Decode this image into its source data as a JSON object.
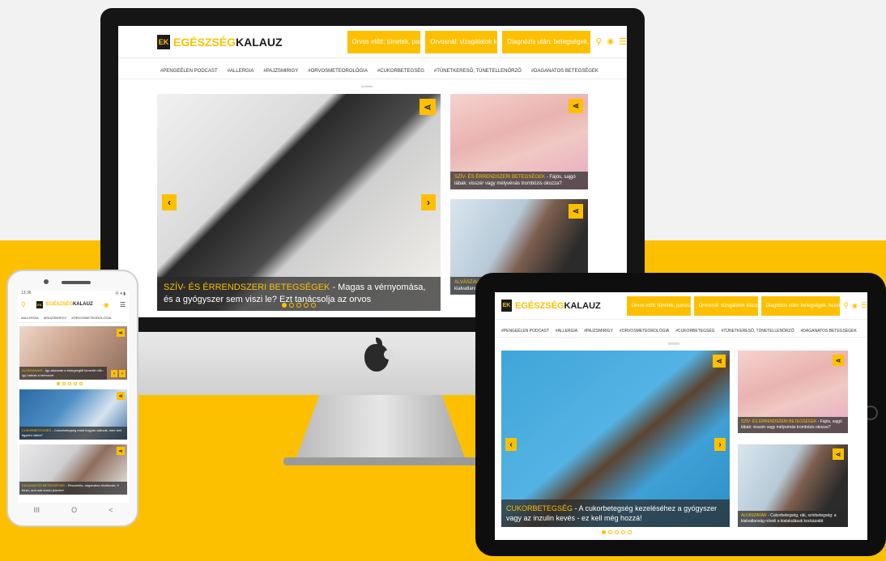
{
  "site": {
    "logo_mark": "EK",
    "logo_part1": "EGÉSZSÉG",
    "logo_part2": "KALAUZ",
    "accent": "#fdc000"
  },
  "menu": {
    "item1": "Orvos előtt: tünetek, panaszok ▾",
    "item2": "Orvosnál: vizsgálatok között ▾",
    "item3": "Diagnózis után: betegségek, kezelések ▾"
  },
  "tags": [
    "#PENGEÉLEN PODCAST",
    "#ALLERGIA",
    "#PAJZSMIRIGY",
    "#ORVOSMETEOROLÓGIA",
    "#CUKORBETEGSÉG",
    "#TÜNETKERESŐ, TÜNETELLENŐRZŐ",
    "#DAGANATOS BETEGSÉGEK"
  ],
  "ad_label": "hirdetés",
  "icons": {
    "share": "share-icon",
    "search": "search-icon",
    "user": "user-icon",
    "menu": "hamburger-icon",
    "prev": "chevron-left-icon",
    "next": "chevron-right-icon"
  },
  "desktop": {
    "hero": {
      "category": "SZÍV- ÉS ÉRRENDSZERI BETEGSÉGEK",
      "title": " - Magas a vérnyomása, és a gyógyszer sem viszi le? Ezt tanácsolja az orvos"
    },
    "side1": {
      "category": "SZÍV- ÉS ÉRRENDSZERI BETEGSÉGEK",
      "title": " - Fájós, sajgó lábak: visszér vagy mélyvénás trombózis okozza?"
    },
    "side2": {
      "category": "ALVÁSZAVAR",
      "title": " - Cukorbetegség, rák, szívbetegség: a kialvatlanság növeli a kialakulásuk kockázatát"
    }
  },
  "tablet": {
    "hero": {
      "category": "CUKORBETEGSÉG",
      "title": " - A cukorbetegség kezeléséhez a gyógyszer vagy az inzulin kevés - ez kell még hozzá!"
    },
    "side1": {
      "category": "SZÍV- ÉS ÉRRENDSZERI BETEGSÉGEK",
      "title": " - Fájós, sajgó lábak: visszér vagy mélyvénás trombózis okozza?"
    },
    "side2": {
      "category": "ALVÁSZAVAR",
      "title": " - Cukorbetegség, rák, szívbetegség: a kialvatlanság növeli a kialakulásuk kockázatát"
    }
  },
  "phone": {
    "status_time": "13:36",
    "status_icons": "⦿ ▾ ▮",
    "tags": [
      "#ALLERGIA",
      "#PAJZSMIRIGY",
      "#ORVOSMETEOROLÓGIA"
    ],
    "card1": {
      "category": "ALVÁSZAVAR",
      "title": " - Így alszanak a betegségtől kimerült nők - így hatnak a stresszre"
    },
    "card2": {
      "category": "CUKORBETEGSÉG",
      "title": " - Cukorbetegség miatt hogyan változik, mire kell figyelni utána?"
    },
    "card3": {
      "category": "DAGANATOS BETEGSÉGEK",
      "title": " - Reszketés, daganatos elváltozás: 9 tünet, ami már korán jelezhet"
    },
    "nav": [
      "III",
      "O",
      "<"
    ]
  }
}
